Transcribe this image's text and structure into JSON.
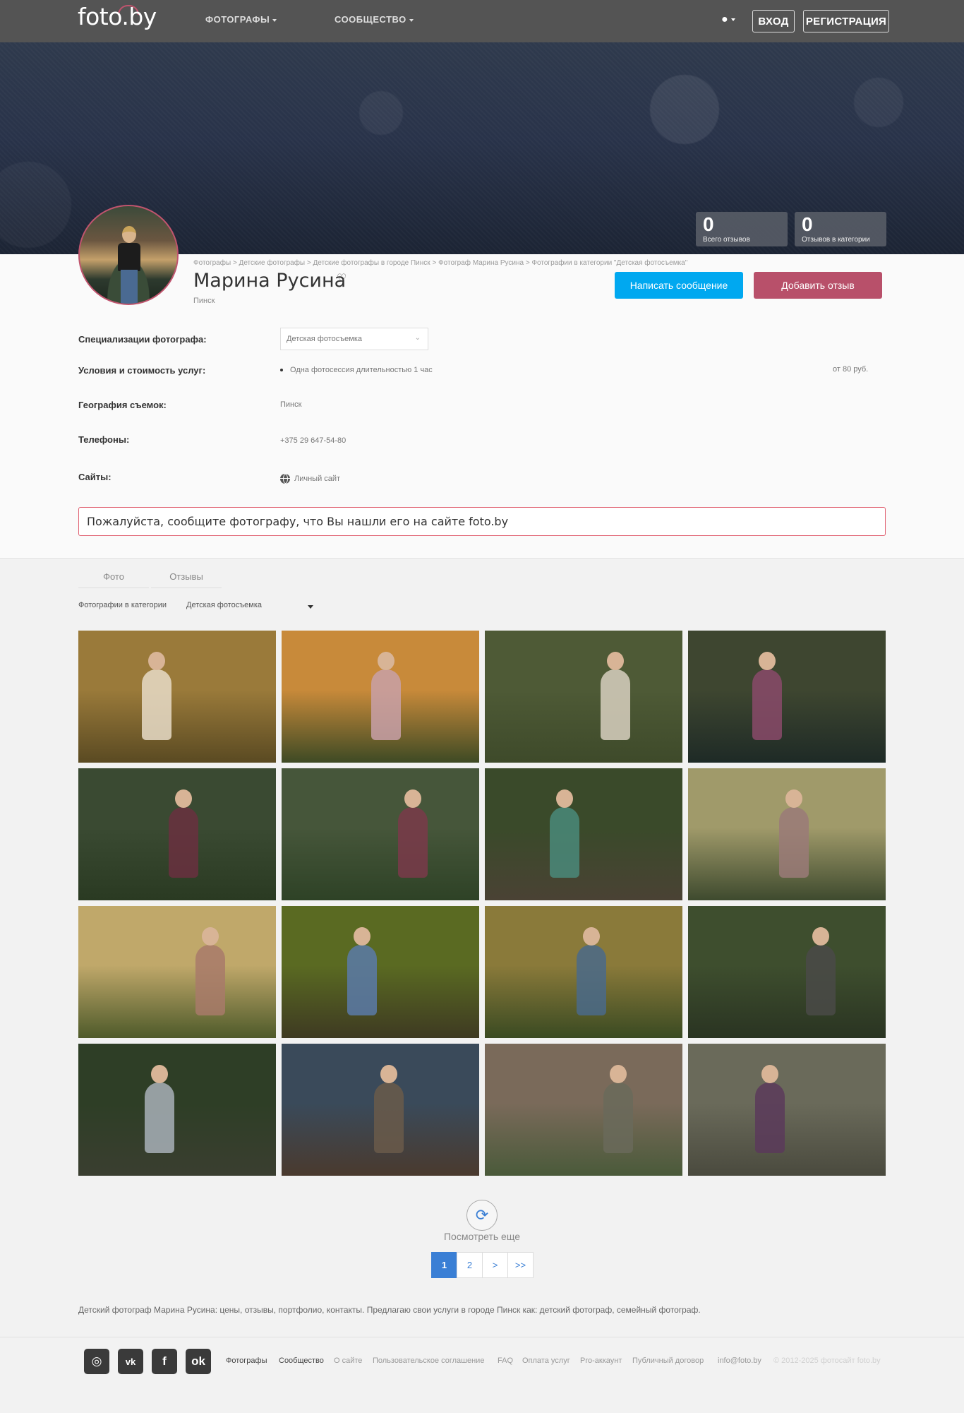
{
  "header": {
    "logo": "foto.by",
    "nav": [
      "ФОТОГРАФЫ",
      "СООБЩЕСТВО"
    ],
    "login": "ВХОД",
    "register": "РЕГИСТРАЦИЯ"
  },
  "stats": [
    {
      "value": "0",
      "label": "Всего отзывов"
    },
    {
      "value": "0",
      "label": "Отзывов в категории"
    }
  ],
  "profile": {
    "breadcrumb": "Фотографы > Детские фотографы > Детские фотографы в городе Пинск > Фотограф Марина Русина > Фотографии в категории \"Детская фотосъемка\"",
    "name": "Марина Русина",
    "city": "Пинск",
    "message_button": "Написать сообщение",
    "review_button": "Добавить отзыв"
  },
  "details": {
    "specialization_label": "Специализации фотографа:",
    "specialization_value": "Детская фотосъемка",
    "services_label": "Условия и стоимость услуг:",
    "service_name": "Одна фотосессия длительностью 1 час",
    "service_price": "от 80 руб.",
    "geography_label": "География съемок:",
    "geography_value": "Пинск",
    "phones_label": "Телефоны:",
    "phone_value": "+375 29 647-54-80",
    "sites_label": "Сайты:",
    "site_value": "Личный сайт"
  },
  "notice": "Пожалуйста, сообщите фотографу, что Вы нашли его на сайте foto.by",
  "tabs": [
    "Фото",
    "Отзывы"
  ],
  "filter": {
    "label": "Фотографии в категории",
    "value": "Детская фотосъемка"
  },
  "photos": [
    {
      "sky": "#9a7a3a",
      "ground": "#5a4a22",
      "fig": "#e8dcc8"
    },
    {
      "sky": "#c88a3a",
      "ground": "#3e4a24",
      "fig": "#c8a0a8"
    },
    {
      "sky": "#4e5a36",
      "ground": "#3e4a2a",
      "fig": "#d8d0c0"
    },
    {
      "sky": "#3e4630",
      "ground": "#1e2a26",
      "fig": "#8a4a6a"
    },
    {
      "sky": "#3a4a32",
      "ground": "#2a3a22",
      "fig": "#6a3040"
    },
    {
      "sky": "#46563a",
      "ground": "#2e4226",
      "fig": "#7a3a4a"
    },
    {
      "sky": "#3a4a2a",
      "ground": "#4a4234",
      "fig": "#4a8a7a"
    },
    {
      "sky": "#a09a6a",
      "ground": "#3e4a2e",
      "fig": "#9a7a78"
    },
    {
      "sky": "#c0a86a",
      "ground": "#4e5a2a",
      "fig": "#a87a6a"
    },
    {
      "sky": "#5a6a22",
      "ground": "#3e3a22",
      "fig": "#5a7aa8"
    },
    {
      "sky": "#8a7a3a",
      "ground": "#3a4a22",
      "fig": "#4a6a8a"
    },
    {
      "sky": "#3e4e2e",
      "ground": "#2a3422",
      "fig": "#4a4a48"
    },
    {
      "sky": "#2e3e26",
      "ground": "#3a3e30",
      "fig": "#a8b0b8"
    },
    {
      "sky": "#3a4a5a",
      "ground": "#4a3a2e",
      "fig": "#6a5a4a"
    },
    {
      "sky": "#7a6a5a",
      "ground": "#4a5a3a",
      "fig": "#6a6a5a"
    },
    {
      "sky": "#6a6a5a",
      "ground": "#4a4a3e",
      "fig": "#5a3a5a"
    }
  ],
  "more": "Посмотреть еще",
  "pager": [
    "1",
    "2",
    ">",
    ">>"
  ],
  "seo": "Детский фотограф Марина Русина: цены, отзывы, портфолио, контакты. Предлагаю свои услуги в городе Пинск как: детский фотограф, семейный фотограф.",
  "social": [
    "instagram-icon",
    "vk-icon",
    "facebook-icon",
    "odnoklassniki-icon"
  ],
  "footer_links": [
    "Фотографы",
    "Сообщество",
    "О сайте",
    "Пользовательское соглашение",
    "FAQ",
    "Оплата услуг",
    "Pro-аккаунт",
    "Публичный договор",
    "info@foto.by"
  ],
  "copyright": "© 2012-2025 фотосайт foto.by",
  "colors": {
    "accent_blue": "#00a8f0",
    "accent_rose": "#b8506a",
    "header": "#545454"
  }
}
